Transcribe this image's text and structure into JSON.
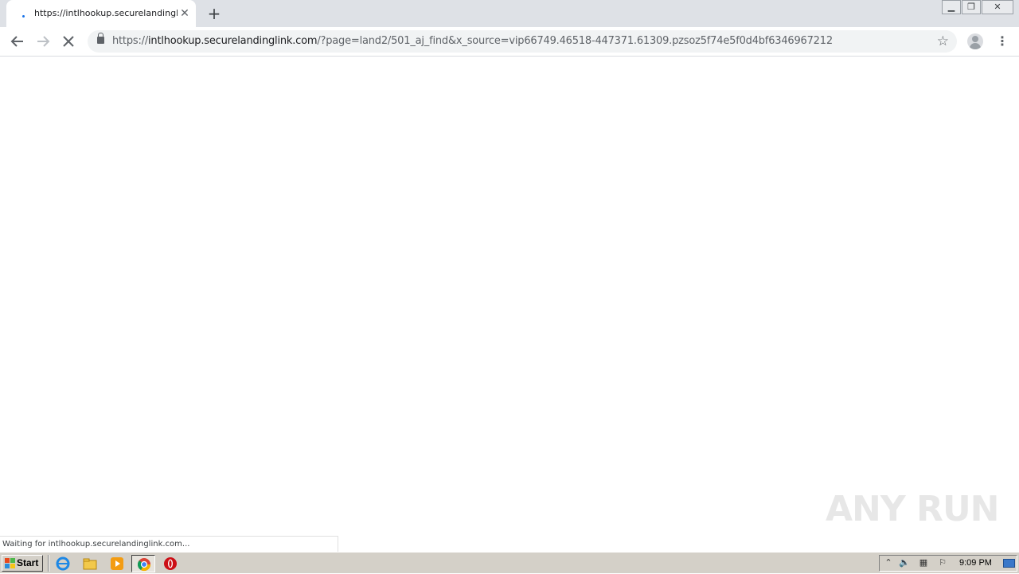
{
  "browser": {
    "tab": {
      "title": "https://intlhookup.securelandinglink.",
      "close_icon": "close-icon",
      "favicon": "loading-favicon"
    },
    "new_tab_icon": "plus-icon",
    "window_controls": [
      "minimize-icon",
      "restore-icon",
      "close-icon"
    ],
    "nav": {
      "back_icon": "arrow-left-icon",
      "forward_icon": "arrow-right-icon",
      "stop_icon": "stop-loading-icon"
    },
    "address_bar": {
      "url_prefix": "https://",
      "url_host": "intlhookup.securelandinglink.com",
      "url_rest": "/?page=land2/501_aj_find&x_source=vip66749.46518-447371.61309.pzsoz5f74e5f0d4bf6346967212",
      "lock_icon": "lock-icon",
      "bookmark_icon": "star-icon"
    },
    "profile_icon": "profile-avatar-icon",
    "menu_icon": "kebab-menu-icon",
    "status_text": "Waiting for intlhookup.securelandinglink.com..."
  },
  "watermark": {
    "text": "ANY RUN"
  },
  "taskbar": {
    "start_label": "Start",
    "quick_launch": [
      "internet-explorer-icon",
      "folder-icon",
      "media-player-icon",
      "chrome-icon",
      "opera-icon"
    ],
    "tray_icons": [
      "show-hidden-icons-icon",
      "volume-icon",
      "network-icon",
      "action-center-flag-icon"
    ],
    "clock": "9:09 PM",
    "show_desktop_icon": "show-desktop-icon"
  },
  "colors": {
    "tabstrip": "#dee1e6",
    "omnibox": "#f1f3f4",
    "taskbar": "#d4d0c8",
    "accent": "#1a73e8"
  }
}
